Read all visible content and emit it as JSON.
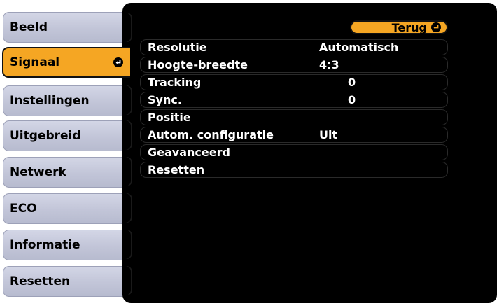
{
  "tabs": [
    {
      "label": "Beeld",
      "active": false
    },
    {
      "label": "Signaal",
      "active": true
    },
    {
      "label": "Instellingen",
      "active": false
    },
    {
      "label": "Uitgebreid",
      "active": false
    },
    {
      "label": "Netwerk",
      "active": false
    },
    {
      "label": "ECO",
      "active": false
    },
    {
      "label": "Informatie",
      "active": false
    },
    {
      "label": "Resetten",
      "active": false
    }
  ],
  "back_button": {
    "label": "Terug",
    "icon": "enter-icon"
  },
  "menu": [
    {
      "label": "Resolutie",
      "value": "Automatisch"
    },
    {
      "label": "Hoogte-breedte",
      "value": "4:3"
    },
    {
      "label": "Tracking",
      "value": "0"
    },
    {
      "label": "Sync.",
      "value": "0"
    },
    {
      "label": "Positie",
      "value": ""
    },
    {
      "label": "Autom. configuratie",
      "value": "Uit"
    },
    {
      "label": "Geavanceerd",
      "value": ""
    },
    {
      "label": "Resetten",
      "value": ""
    }
  ],
  "colors": {
    "accent": "#f5a623",
    "panel": "#000000",
    "tab": "#c2c5d8"
  }
}
